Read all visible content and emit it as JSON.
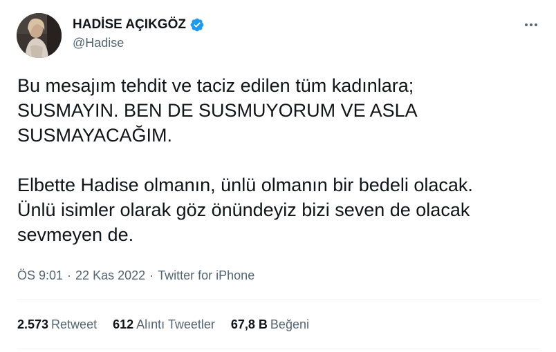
{
  "author": {
    "display_name": "HADİSE AÇIKGÖZ",
    "handle": "@Hadise",
    "verified": true
  },
  "tweet": {
    "paragraph1": "Bu mesajım tehdit ve taciz edilen tüm kadınlara;\nSUSMAYIN. BEN DE SUSMUYORUM VE ASLA\nSUSMAYACAĞIM.",
    "paragraph2": "Elbette Hadise olmanın, ünlü olmanın bir bedeli olacak.\nÜnlü isimler olarak göz önündeyiz bizi seven de olacak\nsevmeyen de."
  },
  "meta": {
    "time": "ÖS 9:01",
    "date": "22 Kas 2022",
    "source": "Twitter for iPhone",
    "separator": "·"
  },
  "stats": {
    "retweets": {
      "count": "2.573",
      "label": "Retweet"
    },
    "quotes": {
      "count": "612",
      "label": "Alıntı Tweetler"
    },
    "likes": {
      "count": "67,8 B",
      "label": "Beğeni"
    }
  },
  "icons": {
    "verified": "verified-badge-icon",
    "more": "more-horizontal-icon"
  },
  "colors": {
    "text": "#0f1419",
    "secondary": "#536471",
    "verified": "#1d9bf0",
    "divider": "#eff3f4"
  }
}
